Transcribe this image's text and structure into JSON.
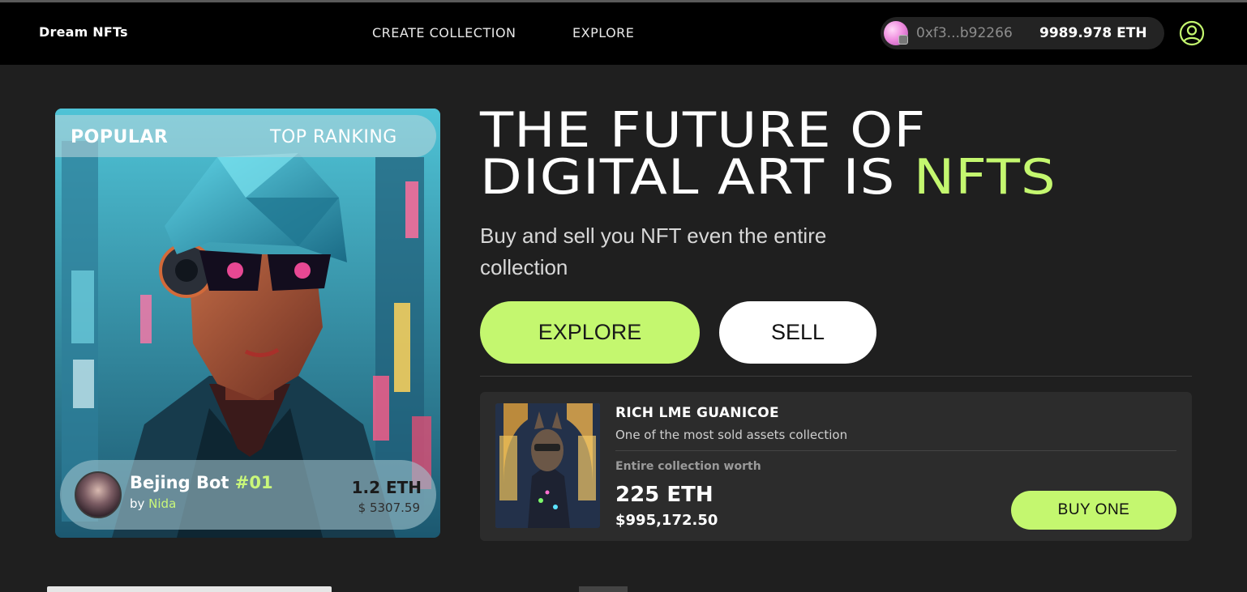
{
  "header": {
    "brand": "Dream NFTs",
    "nav": {
      "create_collection": "CREATE COLLECTION",
      "explore": "EXPLORE"
    },
    "wallet": {
      "address": "0xf3...b92266",
      "balance": "9989.978 ETH"
    },
    "profile_icon": "user-circle-icon"
  },
  "featured_nft": {
    "tag_left": "POPULAR",
    "tag_right": "TOP RANKING",
    "name": "Bejing Bot ",
    "number": "#01",
    "by_prefix": "by ",
    "creator": "Nida",
    "price_eth": "1.2 ETH",
    "price_usd": "$ 5307.59"
  },
  "hero": {
    "title_line1": "THE FUTURE OF",
    "title_line2_prefix": "DIGITAL ART IS ",
    "title_line2_accent": "NFTS",
    "subtitle": "Buy and sell you NFT even the entire collection",
    "explore_button": "EXPLORE",
    "sell_button": "SELL"
  },
  "collection": {
    "title": "RICH LME GUANICOE",
    "description": "One of the most sold assets collection",
    "worth_label": "Entire collection worth",
    "worth_eth": "225 ETH",
    "worth_usd": "$995,172.50",
    "buy_button": "BUY ONE"
  },
  "colors": {
    "accent": "#c4f76f",
    "background": "#1f1f1f",
    "navbar": "#000000"
  }
}
